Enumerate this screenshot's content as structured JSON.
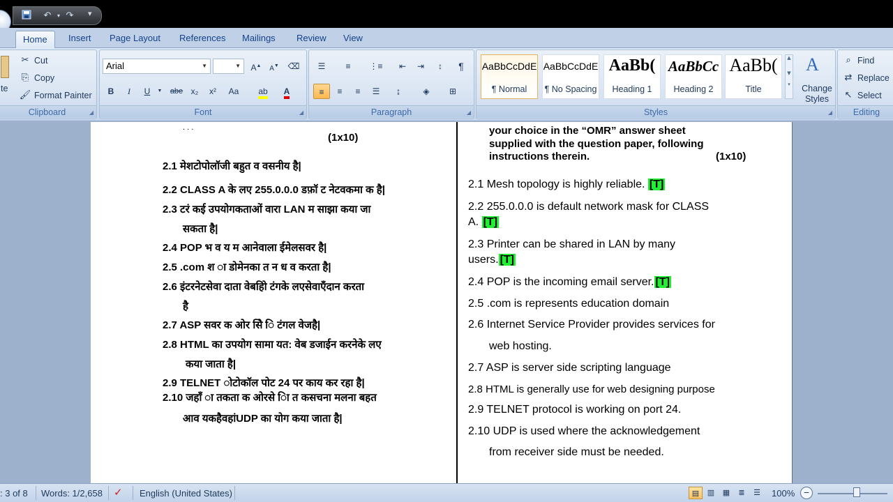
{
  "quick_access": {
    "save_icon": "save-icon",
    "undo_icon": "undo-icon",
    "redo_icon": "redo-icon",
    "more_label": "▾"
  },
  "tabs": [
    {
      "label": "Home",
      "active": true
    },
    {
      "label": "Insert"
    },
    {
      "label": "Page Layout"
    },
    {
      "label": "References"
    },
    {
      "label": "Mailings"
    },
    {
      "label": "Review"
    },
    {
      "label": "View"
    }
  ],
  "clipboard": {
    "paste_label": "te",
    "cut_label": "Cut",
    "copy_label": "Copy",
    "format_painter_label": "Format Painter",
    "group_label": "Clipboard"
  },
  "font": {
    "font_name": "Arial",
    "font_size": "",
    "group_label": "Font",
    "buttons": [
      "B",
      "I",
      "U",
      "abe",
      "x₂",
      "x²",
      "Aa"
    ]
  },
  "paragraph": {
    "group_label": "Paragraph"
  },
  "styles": {
    "group_label": "Styles",
    "items": [
      {
        "sample": "AaBbCcDdE",
        "name": "¶ Normal",
        "selected": true
      },
      {
        "sample": "AaBbCcDdE",
        "name": "¶ No Spacing"
      },
      {
        "sample": "AaBb(",
        "name": "Heading 1"
      },
      {
        "sample": "AaBbCc",
        "name": "Heading 2"
      },
      {
        "sample": "AaBb(",
        "name": "Title"
      }
    ],
    "change_styles_label": "Change Styles"
  },
  "editing": {
    "find_label": "Find",
    "replace_label": "Replace",
    "select_label": "Select",
    "group_label": "Editing"
  },
  "document": {
    "left": {
      "top_fragment": "(1x10)",
      "lines": [
        "2.1  मेशटोपोलॉजी बहुत व वसनीय है|",
        "2.2  CLASS A के लए 255.0.0.0  डफ़ॉ ट नेटवकमा क है|",
        "2.3      टरं कई उपयोगकताओं वारा LAN म साझा  कया जा",
        "सकता है|",
        "2.4  POP भ व य म आनेवाला ईमेलसवर है|",
        "2.5  .com श    ा डोमेनका       त न ध व करता है|",
        "2.6  इंटरनेटसेवा दाता वेबहोि टंगके लएसेवाएँदान करता",
        "है",
        "2.7  ASP सवर क ओर सेि       ि टंगल वेजहै|",
        "2.8  HTML का उपयोग सामा यत: वेब डजाईन करनेके लए",
        "कया जाता है|",
        "2.9   TELNET  ोटोकॉल पोट 24 पर काय कर रहा है|",
        "2.10  जहाँ ा तकता क ओरसे ाि त कसचना     मलना बहत",
        "आव यकहैवहांUDP का       योग कया जाता है|"
      ]
    },
    "right": {
      "top_lines": [
        "your  choice  in  the  “OMR”  answer  sheet",
        "supplied with the question paper, following",
        "instructions therein."
      ],
      "top_marks": "(1x10)",
      "lines": [
        {
          "text": "2.1 Mesh topology is highly reliable. ",
          "tag": "[T]"
        },
        {
          "text": "2.2  255.0.0.0 is default network mask for CLASS"
        },
        {
          "text": "A. ",
          "tag": "[T]"
        },
        {
          "text": "2.3 Printer can be shared in LAN by many"
        },
        {
          "text": "users.",
          "tag": "[T]"
        },
        {
          "text": "2.4 POP is the incoming email server.",
          "tag": "[T]"
        },
        {
          "text": "2.5 .com is represents education domain"
        },
        {
          "text": "2.6  Internet  Service  Provider  provides  services  for"
        },
        {
          "text": "web hosting."
        },
        {
          "text": "2.7 ASP is server side scripting language"
        },
        {
          "text": "2.8 HTML is generally use for web designing purpose"
        },
        {
          "text": "2.9 TELNET protocol is working on port 24."
        },
        {
          "text": "2.10  UDP  is  used  where  the  acknowledgement"
        },
        {
          "text": "from receiver side must be needed."
        }
      ]
    }
  },
  "status": {
    "page": ": 3 of 8",
    "words": "Words: 1/2,658",
    "language": "English (United States)",
    "zoom": "100%"
  },
  "colors": {
    "highlight": "#22ee33",
    "ribbon_text": "#1e395b",
    "tab_text": "#15428b"
  }
}
